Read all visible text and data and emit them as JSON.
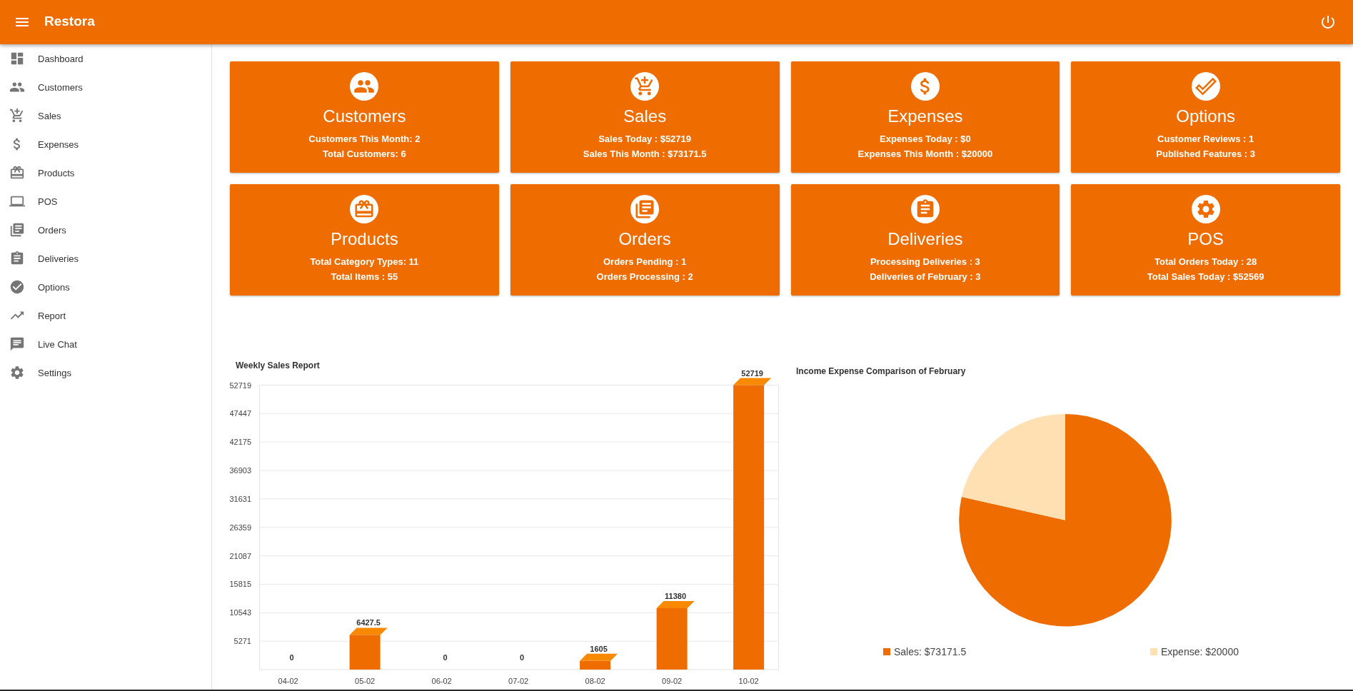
{
  "app_bar": {
    "title": "Restora"
  },
  "sidebar": {
    "items": [
      {
        "label": "Dashboard",
        "selected": false
      },
      {
        "label": "Customers",
        "selected": false
      },
      {
        "label": "Sales",
        "selected": false
      },
      {
        "label": "Expenses",
        "selected": false
      },
      {
        "label": "Products",
        "selected": false
      },
      {
        "label": "POS",
        "selected": false
      },
      {
        "label": "Orders",
        "selected": false
      },
      {
        "label": "Deliveries",
        "selected": false
      },
      {
        "label": "Options",
        "selected": false
      },
      {
        "label": "Report",
        "selected": false
      },
      {
        "label": "Live Chat",
        "selected": false
      },
      {
        "label": "Settings",
        "selected": false
      }
    ]
  },
  "stat_cards": [
    {
      "title": "Customers",
      "lines": [
        "Customers This Month: 2",
        "Total Customers: 6"
      ]
    },
    {
      "title": "Sales",
      "lines": [
        "Sales Today : $52719",
        "Sales This Month : $73171.5"
      ]
    },
    {
      "title": "Expenses",
      "lines": [
        "Expenses Today : $0",
        "Expenses This Month : $20000"
      ]
    },
    {
      "title": "Options",
      "lines": [
        "Customer Reviews : 1",
        "Published Features : 3"
      ]
    },
    {
      "title": "Products",
      "lines": [
        "Total Category Types: 11",
        "Total Items : 55"
      ]
    },
    {
      "title": "Orders",
      "lines": [
        "Orders Pending : 1",
        "Orders Processing : 2"
      ]
    },
    {
      "title": "Deliveries",
      "lines": [
        "Processing Deliveries : 3",
        "Deliveries of February : 3"
      ]
    },
    {
      "title": "POS",
      "lines": [
        "Total Orders Today : 28",
        "Total Sales Today : $52569"
      ]
    }
  ],
  "weekly_sales": {
    "chart_data": {
      "type": "bar",
      "title": "Weekly Sales Report",
      "categories": [
        "04-02",
        "05-02",
        "06-02",
        "07-02",
        "08-02",
        "09-02",
        "10-02"
      ],
      "series": [
        {
          "color": "#ef6c00",
          "values": [
            0,
            6427.5,
            0,
            0,
            1605,
            11380,
            52719
          ]
        }
      ],
      "ylim": [
        0,
        52719
      ],
      "yticks": [
        5271,
        10543,
        15815,
        21087,
        26359,
        31631,
        36903,
        42175,
        47447,
        52719
      ],
      "grid": true,
      "data_labels": true
    }
  },
  "income_expense": {
    "chart_data": {
      "type": "pie",
      "title": "Income Expense Comparison of February",
      "categories": [
        "Sales: $73171.5",
        "Expense: $20000"
      ],
      "values": [
        73171.5,
        20000
      ],
      "legend": "bottom"
    },
    "slices": [
      {
        "color": "#ef6c00"
      },
      {
        "color": "#ffe0b2"
      }
    ]
  }
}
